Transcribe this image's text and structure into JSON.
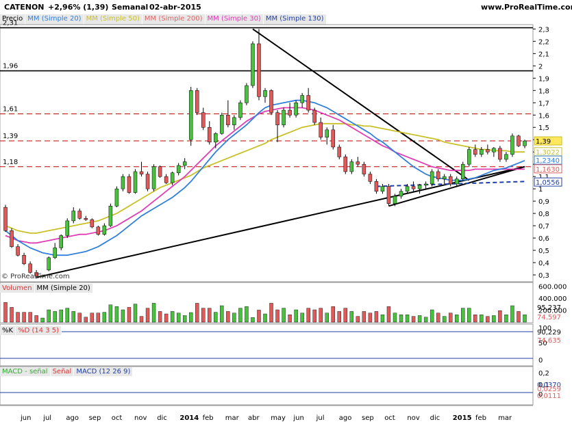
{
  "header": {
    "ticker": "CATENON",
    "change": "+2,96% (1,39)",
    "period": "Semanal",
    "date": "02-abr-2015",
    "site": "www.ProRealTime.com"
  },
  "copyright": "© ProRealTime.com",
  "legend_main": {
    "price": "Precio",
    "mm20": "MM (Simple 20)",
    "mm50": "MM (Simple 50)",
    "mm200": "MM (Simple 200)",
    "mm30": "MM (Simple 30)",
    "mm130": "MM (Simple 130)"
  },
  "legend_volume": {
    "vol": "Volumen",
    "mm": "MM (Simple 20)"
  },
  "legend_stoch": {
    "k": "%K",
    "d": "%D (14 3 5)"
  },
  "legend_macd": {
    "hist": "MACD - señal",
    "signal": "Señal",
    "macd": "MACD (12 26 9)"
  },
  "colors": {
    "up": "#49c13f",
    "down": "#e05a5a",
    "mm20": "#2f7fdc",
    "mm50": "#c8c024",
    "mm30": "#e23cb4",
    "mm130": "#1f3ea3",
    "hline": "#000000",
    "resline": "#c00000"
  },
  "price_levels": {
    "h231": "2,31",
    "h196": "1,96",
    "h161": "1,61",
    "h139": "1,39",
    "h118": "1,18"
  },
  "value_boxes": {
    "last": "1,39",
    "mm50": "1,3022",
    "mm20": "1,2340",
    "mm30": "1,1630",
    "mm130": "1,0556",
    "vol_mm": "95.237",
    "vol_last": "74.597",
    "k": "90,229",
    "d": "74,635",
    "macd": "0,0370",
    "signal": "0,0259",
    "hist": "0,0111"
  },
  "chart_data": [
    {
      "type": "line",
      "title": "CATENON",
      "y_ticks": [
        "2,3",
        "2,2",
        "2,1",
        "2",
        "1,9",
        "1,8",
        "1,7",
        "1,6",
        "1,5",
        "1,4",
        "1,3",
        "1,2",
        "1,1",
        "1",
        "0,9",
        "0,8",
        "0,7",
        "0,6",
        "0,5",
        "0,4",
        "0,3"
      ],
      "ylim": [
        0.25,
        2.33
      ],
      "x_ticks": [
        "jun",
        "jul",
        "ago",
        "sep",
        "oct",
        "nov",
        "dic",
        "2014",
        "feb",
        "mar",
        "abr",
        "may",
        "jun",
        "jul",
        "ago",
        "sep",
        "oct",
        "nov",
        "dic",
        "2015",
        "feb",
        "mar"
      ],
      "candles": [
        [
          0.85,
          0.87,
          0.65,
          0.66
        ],
        [
          0.66,
          0.68,
          0.52,
          0.53
        ],
        [
          0.53,
          0.55,
          0.45,
          0.46
        ],
        [
          0.46,
          0.48,
          0.38,
          0.39
        ],
        [
          0.39,
          0.41,
          0.31,
          0.32
        ],
        [
          0.32,
          0.34,
          0.27,
          0.29
        ],
        [
          0.29,
          0.3,
          0.28,
          0.29
        ],
        [
          0.34,
          0.45,
          0.33,
          0.44
        ],
        [
          0.44,
          0.56,
          0.43,
          0.52
        ],
        [
          0.52,
          0.63,
          0.5,
          0.62
        ],
        [
          0.62,
          0.76,
          0.6,
          0.74
        ],
        [
          0.74,
          0.85,
          0.72,
          0.82
        ],
        [
          0.82,
          0.84,
          0.75,
          0.76
        ],
        [
          0.76,
          0.78,
          0.74,
          0.75
        ],
        [
          0.75,
          0.76,
          0.68,
          0.69
        ],
        [
          0.69,
          0.7,
          0.62,
          0.63
        ],
        [
          0.63,
          0.72,
          0.62,
          0.7
        ],
        [
          0.7,
          0.88,
          0.69,
          0.86
        ],
        [
          0.86,
          1.02,
          0.85,
          1.0
        ],
        [
          1.0,
          1.12,
          0.98,
          1.1
        ],
        [
          1.1,
          1.12,
          0.96,
          0.97
        ],
        [
          0.97,
          1.16,
          0.96,
          1.14
        ],
        [
          1.14,
          1.22,
          1.1,
          1.12
        ],
        [
          1.12,
          1.14,
          0.98,
          1.0
        ],
        [
          1.0,
          1.2,
          0.98,
          1.18
        ],
        [
          1.18,
          1.19,
          1.09,
          1.1
        ],
        [
          1.1,
          1.12,
          1.04,
          1.05
        ],
        [
          1.05,
          1.14,
          1.03,
          1.13
        ],
        [
          1.13,
          1.21,
          1.11,
          1.19
        ],
        [
          1.19,
          1.25,
          1.16,
          1.22
        ],
        [
          1.4,
          1.83,
          1.35,
          1.8
        ],
        [
          1.8,
          1.82,
          1.6,
          1.62
        ],
        [
          1.62,
          1.66,
          1.48,
          1.5
        ],
        [
          1.5,
          1.55,
          1.36,
          1.38
        ],
        [
          1.38,
          1.46,
          1.33,
          1.45
        ],
        [
          1.45,
          1.62,
          1.44,
          1.6
        ],
        [
          1.6,
          1.72,
          1.5,
          1.52
        ],
        [
          1.52,
          1.6,
          1.48,
          1.58
        ],
        [
          1.58,
          1.72,
          1.56,
          1.7
        ],
        [
          1.7,
          1.86,
          1.68,
          1.84
        ],
        [
          1.84,
          2.2,
          1.82,
          2.18
        ],
        [
          2.18,
          2.3,
          1.72,
          1.75
        ],
        [
          1.75,
          1.82,
          1.7,
          1.8
        ],
        [
          1.8,
          1.81,
          1.6,
          1.62
        ],
        [
          1.62,
          1.64,
          1.38,
          1.52
        ],
        [
          1.52,
          1.66,
          1.5,
          1.64
        ],
        [
          1.64,
          1.7,
          1.58,
          1.6
        ],
        [
          1.6,
          1.72,
          1.58,
          1.7
        ],
        [
          1.7,
          1.78,
          1.66,
          1.76
        ],
        [
          1.76,
          1.82,
          1.62,
          1.64
        ],
        [
          1.64,
          1.66,
          1.52,
          1.54
        ],
        [
          1.54,
          1.58,
          1.4,
          1.42
        ],
        [
          1.42,
          1.5,
          1.36,
          1.48
        ],
        [
          1.48,
          1.52,
          1.32,
          1.34
        ],
        [
          1.34,
          1.36,
          1.24,
          1.26
        ],
        [
          1.26,
          1.28,
          1.12,
          1.14
        ],
        [
          1.14,
          1.24,
          1.12,
          1.22
        ],
        [
          1.22,
          1.26,
          1.18,
          1.2
        ],
        [
          1.2,
          1.22,
          1.1,
          1.12
        ],
        [
          1.12,
          1.14,
          1.04,
          1.06
        ],
        [
          1.06,
          1.08,
          0.96,
          0.98
        ],
        [
          0.98,
          1.04,
          0.96,
          1.02
        ],
        [
          1.02,
          1.04,
          0.86,
          0.88
        ],
        [
          0.88,
          0.96,
          0.86,
          0.94
        ],
        [
          0.94,
          1.0,
          0.92,
          0.98
        ],
        [
          0.98,
          1.04,
          0.96,
          1.02
        ],
        [
          1.02,
          1.06,
          0.98,
          1.0
        ],
        [
          1.0,
          1.04,
          0.96,
          1.03
        ],
        [
          1.03,
          1.06,
          1.0,
          1.04
        ],
        [
          1.04,
          1.16,
          1.02,
          1.14
        ],
        [
          1.14,
          1.16,
          1.06,
          1.08
        ],
        [
          1.08,
          1.12,
          1.04,
          1.1
        ],
        [
          1.1,
          1.12,
          1.02,
          1.04
        ],
        [
          1.04,
          1.1,
          1.02,
          1.08
        ],
        [
          1.08,
          1.22,
          1.06,
          1.2
        ],
        [
          1.2,
          1.34,
          1.18,
          1.32
        ],
        [
          1.32,
          1.36,
          1.26,
          1.28
        ],
        [
          1.28,
          1.34,
          1.26,
          1.32
        ],
        [
          1.32,
          1.36,
          1.28,
          1.3
        ],
        [
          1.3,
          1.34,
          1.26,
          1.33
        ],
        [
          1.33,
          1.35,
          1.22,
          1.24
        ],
        [
          1.24,
          1.3,
          1.22,
          1.28
        ],
        [
          1.28,
          1.45,
          1.26,
          1.43
        ],
        [
          1.43,
          1.44,
          1.34,
          1.35
        ],
        [
          1.35,
          1.4,
          1.33,
          1.39
        ]
      ],
      "mm50": [
        0.7,
        0.68,
        0.66,
        0.65,
        0.64,
        0.64,
        0.65,
        0.66,
        0.67,
        0.68,
        0.69,
        0.7,
        0.71,
        0.72,
        0.73,
        0.74,
        0.76,
        0.78,
        0.8,
        0.83,
        0.86,
        0.89,
        0.92,
        0.95,
        0.98,
        1.01,
        1.03,
        1.05,
        1.07,
        1.09,
        1.11,
        1.14,
        1.17,
        1.19,
        1.21,
        1.23,
        1.25,
        1.27,
        1.29,
        1.31,
        1.33,
        1.35,
        1.37,
        1.4,
        1.42,
        1.44,
        1.46,
        1.48,
        1.5,
        1.51,
        1.52,
        1.53,
        1.53,
        1.53,
        1.53,
        1.53,
        1.52,
        1.52,
        1.51,
        1.51,
        1.5,
        1.49,
        1.48,
        1.47,
        1.46,
        1.45,
        1.44,
        1.43,
        1.42,
        1.41,
        1.4,
        1.38,
        1.37,
        1.36,
        1.35,
        1.34,
        1.33,
        1.32,
        1.32,
        1.31,
        1.31,
        1.31,
        1.3,
        1.3,
        1.3
      ],
      "mm20": [
        0.66,
        0.62,
        0.58,
        0.55,
        0.52,
        0.5,
        0.48,
        0.47,
        0.46,
        0.46,
        0.46,
        0.47,
        0.48,
        0.49,
        0.51,
        0.53,
        0.56,
        0.59,
        0.62,
        0.66,
        0.7,
        0.74,
        0.78,
        0.81,
        0.84,
        0.87,
        0.9,
        0.93,
        0.97,
        1.01,
        1.06,
        1.12,
        1.18,
        1.24,
        1.3,
        1.35,
        1.4,
        1.44,
        1.48,
        1.52,
        1.57,
        1.62,
        1.66,
        1.68,
        1.69,
        1.7,
        1.71,
        1.72,
        1.72,
        1.71,
        1.7,
        1.68,
        1.66,
        1.63,
        1.6,
        1.57,
        1.54,
        1.51,
        1.48,
        1.45,
        1.41,
        1.38,
        1.34,
        1.3,
        1.26,
        1.22,
        1.18,
        1.15,
        1.12,
        1.1,
        1.09,
        1.08,
        1.07,
        1.07,
        1.07,
        1.08,
        1.09,
        1.11,
        1.13,
        1.15,
        1.16,
        1.17,
        1.19,
        1.21,
        1.23
      ],
      "mm30": [
        0.62,
        0.6,
        0.58,
        0.57,
        0.56,
        0.56,
        0.57,
        0.58,
        0.59,
        0.6,
        0.61,
        0.62,
        0.63,
        0.63,
        0.64,
        0.65,
        0.66,
        0.68,
        0.7,
        0.73,
        0.76,
        0.79,
        0.82,
        0.86,
        0.9,
        0.94,
        0.98,
        1.02,
        1.06,
        1.1,
        1.15,
        1.2,
        1.25,
        1.3,
        1.35,
        1.39,
        1.43,
        1.47,
        1.51,
        1.55,
        1.58,
        1.61,
        1.63,
        1.64,
        1.65,
        1.66,
        1.66,
        1.66,
        1.66,
        1.65,
        1.64,
        1.62,
        1.6,
        1.58,
        1.56,
        1.53,
        1.5,
        1.47,
        1.44,
        1.41,
        1.38,
        1.35,
        1.33,
        1.3,
        1.28,
        1.26,
        1.24,
        1.22,
        1.2,
        1.18,
        1.17,
        1.16,
        1.15,
        1.15,
        1.15,
        1.15,
        1.16,
        1.16,
        1.16,
        1.16,
        1.16,
        1.16,
        1.16,
        1.16,
        1.16
      ]
    },
    {
      "type": "bar",
      "title": "Volumen",
      "y_ticks": [
        "600.000",
        "400.000",
        "200.000"
      ],
      "ylim": [
        0,
        650000
      ]
    },
    {
      "type": "line",
      "title": "%K %D (14 3 5)",
      "y_ticks": [
        "100",
        "50",
        "0"
      ],
      "ylim": [
        0,
        100
      ]
    },
    {
      "type": "line",
      "title": "MACD (12 26 9)",
      "y_ticks": [
        "0,2",
        "0,1",
        "0"
      ],
      "ylim": [
        -0.12,
        0.22
      ]
    }
  ]
}
